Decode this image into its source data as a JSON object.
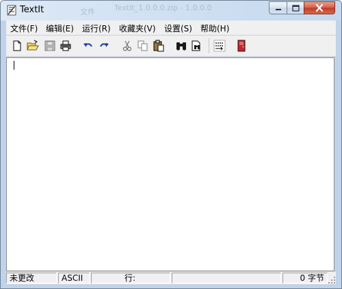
{
  "window": {
    "title": "TextIt",
    "background_tabs": [
      "TextIt_1.0.0.0.zip - 1.0.0.0",
      "文件"
    ]
  },
  "menu": {
    "items": [
      {
        "label": "文件(F)"
      },
      {
        "label": "编辑(E)"
      },
      {
        "label": "运行(R)"
      },
      {
        "label": "收藏夹(V)"
      },
      {
        "label": "设置(S)"
      },
      {
        "label": "帮助(H)"
      }
    ]
  },
  "toolbar": {
    "buttons": [
      {
        "icon": "new-file-icon"
      },
      {
        "icon": "open-folder-icon"
      },
      {
        "icon": "save-disk-icon"
      },
      {
        "icon": "print-icon"
      },
      {
        "icon": "undo-icon"
      },
      {
        "icon": "redo-icon"
      },
      {
        "icon": "cut-icon"
      },
      {
        "icon": "copy-icon"
      },
      {
        "icon": "paste-icon"
      },
      {
        "icon": "find-binoculars-icon"
      },
      {
        "icon": "find-next-icon"
      },
      {
        "icon": "word-wrap-icon"
      },
      {
        "icon": "exit-door-icon"
      }
    ]
  },
  "editor": {
    "content": ""
  },
  "statusbar": {
    "modified": "未更改",
    "encoding": "ASCII",
    "line_label": "行:",
    "char_count": "0 字节"
  },
  "colors": {
    "titlebar": "#d2e2f3",
    "chrome": "#f0f0f0",
    "close_button": "#c13a22",
    "undo_redo": "#1c3e9c",
    "exit_icon": "#c0262c"
  }
}
